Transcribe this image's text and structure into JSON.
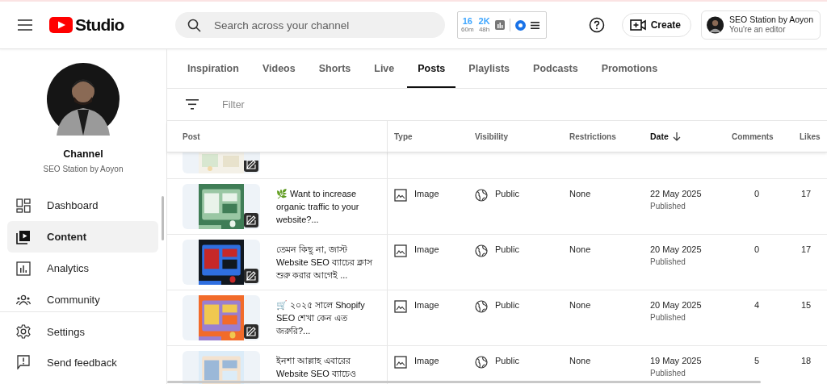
{
  "logo": {
    "text": "Studio"
  },
  "search": {
    "placeholder": "Search across your channel"
  },
  "stats": [
    {
      "value": "16",
      "period": "60m"
    },
    {
      "value": "2K",
      "period": "48h"
    }
  ],
  "create_button": {
    "label": "Create"
  },
  "account": {
    "name": "SEO Station by Aoyon",
    "role": "You're an editor"
  },
  "channel": {
    "label": "Channel",
    "name": "SEO Station by Aoyon"
  },
  "nav": [
    {
      "label": "Dashboard",
      "selected": false
    },
    {
      "label": "Content",
      "selected": true
    },
    {
      "label": "Analytics",
      "selected": false
    },
    {
      "label": "Community",
      "selected": false
    }
  ],
  "nav_footer": [
    {
      "label": "Settings"
    },
    {
      "label": "Send feedback"
    }
  ],
  "tabs": [
    {
      "label": "Inspiration",
      "selected": false
    },
    {
      "label": "Videos",
      "selected": false
    },
    {
      "label": "Shorts",
      "selected": false
    },
    {
      "label": "Live",
      "selected": false
    },
    {
      "label": "Posts",
      "selected": true
    },
    {
      "label": "Playlists",
      "selected": false
    },
    {
      "label": "Podcasts",
      "selected": false
    },
    {
      "label": "Promotions",
      "selected": false
    }
  ],
  "filter": {
    "placeholder": "Filter"
  },
  "table": {
    "columns": [
      {
        "label": "Post",
        "sorted": false
      },
      {
        "label": "Type",
        "sorted": false
      },
      {
        "label": "Visibility",
        "sorted": false
      },
      {
        "label": "Restrictions",
        "sorted": false
      },
      {
        "label": "Date",
        "sorted": true
      },
      {
        "label": "Comments",
        "sorted": false
      },
      {
        "label": "Likes",
        "sorted": false
      }
    ],
    "rows": [
      {
        "title": "🌿 Want to increase organic traffic to your website?...",
        "type": "Image",
        "visibility": "Public",
        "restrictions": "None",
        "date": "22 May 2025",
        "status": "Published",
        "comments": "0",
        "likes": "17"
      },
      {
        "title": "তেমন কিছু না, জাস্ট Website SEO ব্যাচের ক্লাস শুরু করার আগেই ...",
        "type": "Image",
        "visibility": "Public",
        "restrictions": "None",
        "date": "20 May 2025",
        "status": "Published",
        "comments": "0",
        "likes": "17"
      },
      {
        "title": "🛒 ২০২৫ সালে Shopify SEO শেখা কেন এত জরুরি?...",
        "type": "Image",
        "visibility": "Public",
        "restrictions": "None",
        "date": "20 May 2025",
        "status": "Published",
        "comments": "4",
        "likes": "15"
      },
      {
        "title": "ইনশা আল্লাহ এবারের Website SEO ব্যাচেও",
        "type": "Image",
        "visibility": "Public",
        "restrictions": "None",
        "date": "19 May 2025",
        "status": "Published",
        "comments": "5",
        "likes": "18"
      }
    ]
  }
}
